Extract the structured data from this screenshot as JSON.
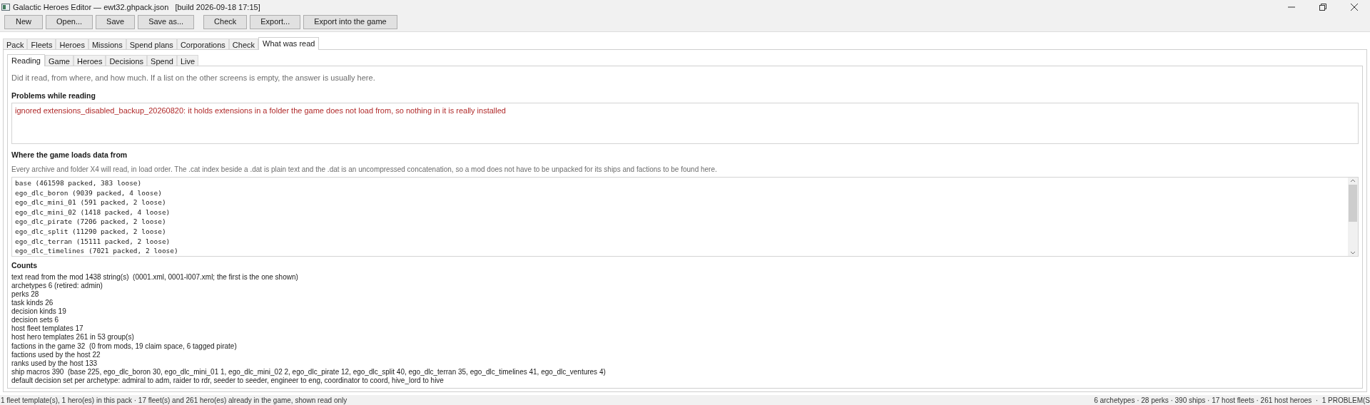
{
  "window": {
    "title": "Galactic Heroes Editor — ewt32.ghpack.json   [build 2026-09-18 17:15]"
  },
  "toolbar": [
    [
      "New",
      "Open...",
      "Save",
      "Save as..."
    ],
    [
      "Check",
      "Export...",
      "Export into the game"
    ]
  ],
  "tabs": [
    {
      "label": "Pack",
      "selected": false
    },
    {
      "label": "Fleets",
      "selected": false
    },
    {
      "label": "Heroes",
      "selected": false
    },
    {
      "label": "Missions",
      "selected": false
    },
    {
      "label": "Spend plans",
      "selected": false
    },
    {
      "label": "Corporations",
      "selected": false
    },
    {
      "label": "Check",
      "selected": false
    },
    {
      "label": "What was read",
      "selected": true
    }
  ],
  "subtabs": [
    {
      "label": "Reading",
      "selected": true
    },
    {
      "label": "Game",
      "selected": false
    },
    {
      "label": "Heroes",
      "selected": false
    },
    {
      "label": "Decisions",
      "selected": false
    },
    {
      "label": "Spend",
      "selected": false
    },
    {
      "label": "Live",
      "selected": false
    }
  ],
  "intro": "Did it read, from where, and how much. If a list on the other screens is empty, the answer is usually here.",
  "problems": {
    "heading": "Problems while reading",
    "items": [
      "ignored extensions_disabled_backup_20260820: it holds extensions in a folder the game does not load from, so nothing in it is really installed"
    ]
  },
  "sources": {
    "heading": "Where the game loads data from",
    "description": "Every archive and folder X4 will read, in load order. The .cat index beside a .dat is plain text and the .dat is an uncompressed concatenation, so a mod does not have to be unpacked for its ships and factions to be found here.",
    "items": [
      "base (461598 packed, 383 loose)",
      "ego_dlc_boron (9039 packed, 4 loose)",
      "ego_dlc_mini_01 (591 packed, 2 loose)",
      "ego_dlc_mini_02 (1418 packed, 4 loose)",
      "ego_dlc_pirate (7206 packed, 2 loose)",
      "ego_dlc_split (11290 packed, 2 loose)",
      "ego_dlc_terran (15111 packed, 2 loose)",
      "ego_dlc_timelines (7021 packed, 2 loose)"
    ]
  },
  "counts": {
    "heading": "Counts",
    "lines": [
      "text read from the mod 1438 string(s)  (0001.xml, 0001-l007.xml; the first is the one shown)",
      "archetypes 6 (retired: admin)",
      "perks 28",
      "task kinds 26",
      "decision kinds 19",
      "decision sets 6",
      "host fleet templates 17",
      "host hero templates 261 in 53 group(s)",
      "factions in the game 32  (0 from mods, 19 claim space, 6 tagged pirate)",
      "factions used by the host 22",
      "ranks used by the host 133",
      "ship macros 390  (base 225, ego_dlc_boron 30, ego_dlc_mini_01 1, ego_dlc_mini_02 2, ego_dlc_pirate 12, ego_dlc_split 40, ego_dlc_terran 35, ego_dlc_timelines 41, ego_dlc_ventures 4)",
      "default decision set per archetype: admiral to adm, raider to rdr, seeder to seeder, engineer to eng, coordinator to coord, hive_lord to hive"
    ]
  },
  "status_bar": {
    "left": "1 fleet template(s), 1 hero(es) in this pack · 17 fleet(s) and 261 hero(es) already in the game, shown read only",
    "right": "6 archetypes · 28 perks · 390 ships · 17 host fleets · 261 host heroes  ·  1 PROBLEM(S"
  }
}
